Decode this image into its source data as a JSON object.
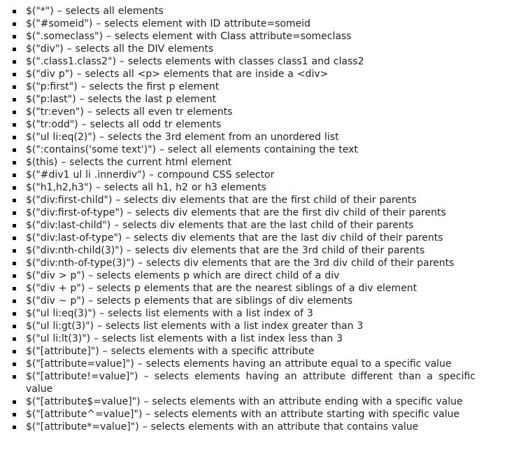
{
  "items": [
    "$(\"*\") – selects all elements",
    "$(\"#someid\") – selects element with ID attribute=someid",
    "$(\".someclass\") – selects element with Class attribute=someclass",
    "$(\"div\") – selects all the DIV elements",
    "$(\".class1.class2\") – selects elements with classes class1 and class2",
    "$(\"div p\") – selects all <p> elements that are inside a <div>",
    "$(\"p:first\") – selects the first p element",
    "$(\"p:last\") – selects the last p element",
    "$(\"tr:even\") – selects all even tr elements",
    "$(\"tr:odd\") – selects all odd tr elements",
    "$(\"ul li:eq(2)\") – selects the 3rd element from an unordered list",
    "$(\":contains('some text')\") – select all elements containing the text",
    "$(this) – selects the current html element",
    "$(\"#div1 ul li .innerdiv\") – compound CSS selector",
    "$(\"h1,h2,h3\") – selects all h1, h2 or h3 elements",
    "$(\"div:first-child\") – selects div elements that are the first child of their parents",
    "$(\"div:first-of-type\") – selects div elements that are the first div child of their parents",
    "$(\"div:last-child\") – selects div elements that are the last child of their parents",
    "$(\"div:last-of-type\") – selects div elements that are the last div child of their parents",
    "$(\"div:nth-child(3)\") – selects div elements that are the 3rd child of their parents",
    "$(\"div:nth-of-type(3)\") – selects div elements that are the 3rd div child of their parents",
    "$(\"div > p\") – selects elements p which are direct child of a div",
    "$(\"div + p\") – selects p elements that are the nearest siblings of a div element",
    "$(\"div ~ p\") – selects p elements that are siblings of div elements",
    "$(\"ul li:eq(3)\") – selects list elements with a list index of 3",
    "$(\"ul li:gt(3)\") – selects list elements with a list index greater than 3",
    "$(\"ul li:lt(3)\") – selects list elements with a list index less than 3",
    "$(\"[attribute]\") – selects elements with a specific attribute",
    "$(\"[attribute=value]\") – selects elements having an attribute equal to a specific value",
    "$(\"[attribute!=value]\") – selects elements having an attribute different than a specific value",
    "$(\"[attribute$=value]\") – selects elements with an attribute ending with a specific value",
    "$(\"[attribute^=value]\") – selects elements with an attribute starting with specific value",
    "$(\"[attribute*=value]\") – selects elements with an attribute that contains value"
  ]
}
